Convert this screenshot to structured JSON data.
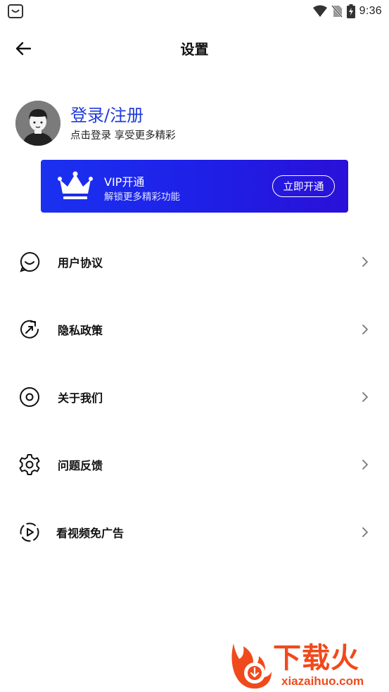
{
  "status_bar": {
    "time": "9:36",
    "icons": [
      "bag-icon",
      "wifi-icon",
      "no-sim-icon",
      "battery-charging-icon"
    ]
  },
  "header": {
    "title": "设置",
    "back_icon": "back-arrow-icon"
  },
  "profile": {
    "title": "登录/注册",
    "subtitle": "点击登录 享受更多精彩",
    "avatar_icon": "default-avatar"
  },
  "vip": {
    "title": "VIP开通",
    "subtitle": "解锁更多精彩功能",
    "button_label": "立即开通",
    "icon": "crown-icon",
    "colors": {
      "start": "#1a31f0",
      "end": "#2a10d8"
    }
  },
  "menu": {
    "items": [
      {
        "label": "用户协议",
        "icon": "smile-bubble-icon"
      },
      {
        "label": "隐私政策",
        "icon": "refresh-icon"
      },
      {
        "label": "关于我们",
        "icon": "target-icon"
      },
      {
        "label": "问题反馈",
        "icon": "gear-icon"
      },
      {
        "label": "看视频免广告",
        "icon": "play-dashed-icon"
      }
    ]
  },
  "watermark": {
    "text": "下载火",
    "sub": "xiazaihuo.com"
  },
  "colors": {
    "accent": "#1f3bd9",
    "watermark": "#f04a1c"
  }
}
